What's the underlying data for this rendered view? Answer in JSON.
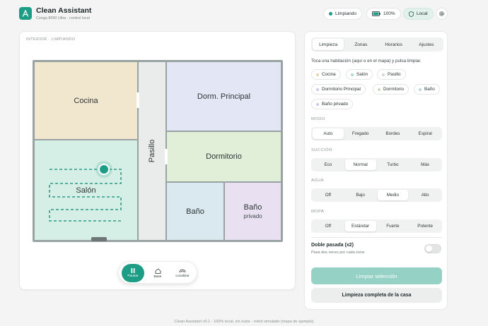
{
  "header": {
    "title": "Clean Assistant",
    "subtitle": "Conga 8090 Ultra - control local",
    "status_label": "Limpiando",
    "battery_label": "100%",
    "mode_label": "Local",
    "accent": "#1e9d86"
  },
  "map": {
    "breadcrumb": "INTERIOR · LIMPIANDO",
    "rooms": {
      "cocina": "Cocina",
      "salon": "Salón",
      "pasillo": "Pasillo",
      "dorm_principal": "Dorm. Principal",
      "dormitorio": "Dormitorio",
      "bano": "Baño",
      "bano_privado_1": "Baño",
      "bano_privado_2": "privado"
    },
    "controls": {
      "pause": "Pausar",
      "base": "Base",
      "locate": "Localizar"
    }
  },
  "panel": {
    "tabs": [
      "Limpieza",
      "Zonas",
      "Horarios",
      "Ajustes"
    ],
    "hint": "Toca una habitación (aquí o en el mapa) y pulsa limpiar.",
    "rooms": [
      {
        "label": "Cocina",
        "color": "#f1e7cf"
      },
      {
        "label": "Salón",
        "color": "#d6efe6"
      },
      {
        "label": "Pasillo",
        "color": "#e9ecea"
      },
      {
        "label": "Dormitorio Principal",
        "color": "#e3e6f5"
      },
      {
        "label": "Dormitorio",
        "color": "#e1efd9"
      },
      {
        "label": "Baño",
        "color": "#d9e9ef"
      },
      {
        "label": "Baño privado",
        "color": "#e9e1f2"
      }
    ],
    "modo": {
      "label": "MODO",
      "options": [
        "Auto",
        "Fregado",
        "Bordes",
        "Espiral"
      ]
    },
    "succion": {
      "label": "SUCCIÓN",
      "options": [
        "Eco",
        "Normal",
        "Turbo",
        "Máx"
      ]
    },
    "agua": {
      "label": "AGUA",
      "options": [
        "Off",
        "Bajo",
        "Medio",
        "Alto"
      ]
    },
    "mopa": {
      "label": "MOPA",
      "options": [
        "Off",
        "Estándar",
        "Fuerte",
        "Potente"
      ]
    },
    "double_pass_title": "Doble pasada (x2)",
    "double_pass_sub": "Pasa dos veces por cada zona",
    "clean_selection": "Limpiar selección",
    "clean_all": "Limpieza completa de la casa"
  },
  "footer": "Clean Assistant v0.1 - 100% local, sin nube - robot simulado (mapa de ejemplo)"
}
